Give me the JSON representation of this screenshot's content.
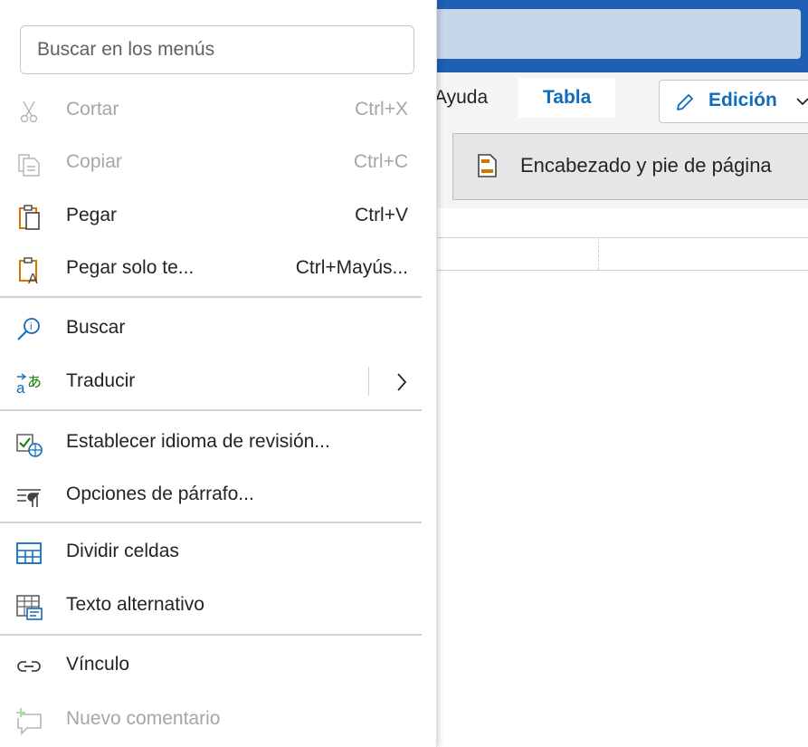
{
  "background": {
    "ribbon_tabs": [
      {
        "label": "Ayuda"
      },
      {
        "label": "Tabla",
        "active": true
      }
    ],
    "edit_button": {
      "label": "Edición"
    },
    "header_footer_button": {
      "label": "Encabezado y pie de página"
    }
  },
  "menu": {
    "search": {
      "placeholder": "Buscar en los menús"
    },
    "items": [
      {
        "label": "Cortar",
        "shortcut": "Ctrl+X",
        "icon": "scissors-icon",
        "disabled": true
      },
      {
        "label": "Copiar",
        "shortcut": "Ctrl+C",
        "icon": "copy-icon",
        "disabled": true
      },
      {
        "label": "Pegar",
        "shortcut": "Ctrl+V",
        "icon": "paste-icon",
        "disabled": false
      },
      {
        "label": "Pegar solo te...",
        "shortcut": "Ctrl+Mayús...",
        "icon": "paste-text-icon",
        "disabled": false
      },
      {
        "label": "Buscar",
        "icon": "smart-lookup-icon",
        "disabled": false
      },
      {
        "label": "Traducir",
        "icon": "translate-icon",
        "disabled": false,
        "has_submenu": true
      },
      {
        "label": "Establecer idioma de revisión...",
        "icon": "proofing-language-icon",
        "disabled": false
      },
      {
        "label": "Opciones de párrafo...",
        "icon": "paragraph-options-icon",
        "disabled": false
      },
      {
        "label": "Dividir celdas",
        "icon": "split-cells-icon",
        "disabled": false
      },
      {
        "label": "Texto alternativo",
        "icon": "alt-text-icon",
        "disabled": false
      },
      {
        "label": "Vínculo",
        "icon": "link-icon",
        "disabled": false
      },
      {
        "label": "Nuevo comentario",
        "icon": "new-comment-icon",
        "disabled": true
      }
    ]
  },
  "colors": {
    "accent": "#0f6cbd",
    "header_blue": "#1f5fb4",
    "icon_orange": "#d47500",
    "disabled_text": "#a6a6a6"
  }
}
